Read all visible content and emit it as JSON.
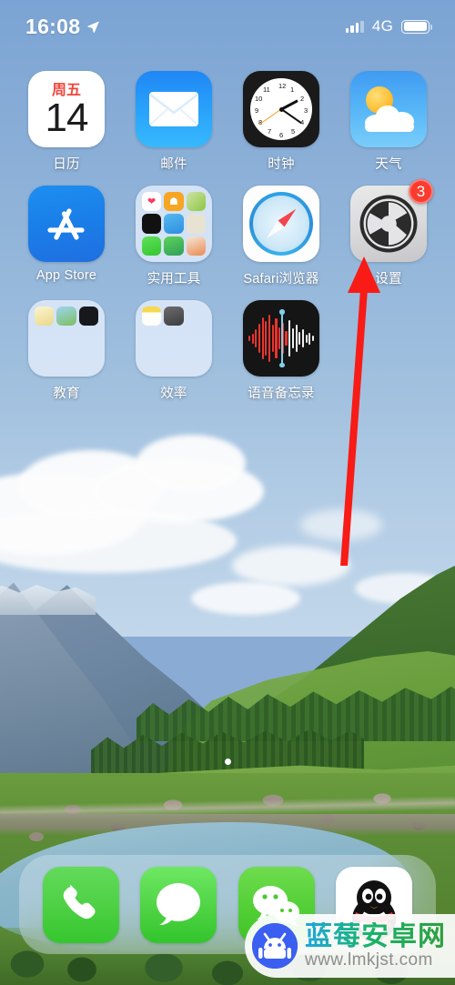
{
  "statusbar": {
    "time": "16:08",
    "location_icon": "location-arrow-icon",
    "signal_icon": "signal-bars-icon",
    "carrier": "4G",
    "battery_icon": "battery-full-icon"
  },
  "home": {
    "page_dots": {
      "count": 1,
      "active_index": 0
    },
    "apps": [
      {
        "id": "calendar",
        "label": "日历",
        "icon": "calendar-icon",
        "badge": null,
        "day_of_week": "周五",
        "day": "14"
      },
      {
        "id": "mail",
        "label": "邮件",
        "icon": "mail-icon",
        "badge": null
      },
      {
        "id": "clock",
        "label": "时钟",
        "icon": "clock-icon",
        "badge": null
      },
      {
        "id": "weather",
        "label": "天气",
        "icon": "weather-icon",
        "badge": null
      },
      {
        "id": "appstore",
        "label": "App Store",
        "icon": "app-store-icon",
        "badge": null
      },
      {
        "id": "utilities",
        "label": "实用工具",
        "icon": "folder-icon",
        "badge": null,
        "is_folder": true
      },
      {
        "id": "safari",
        "label": "Safari浏览器",
        "icon": "safari-icon",
        "badge": null
      },
      {
        "id": "settings",
        "label": "设置",
        "icon": "settings-gear-icon",
        "badge": "3"
      },
      {
        "id": "education",
        "label": "教育",
        "icon": "folder-icon",
        "badge": null,
        "is_folder": true
      },
      {
        "id": "efficiency",
        "label": "效率",
        "icon": "folder-icon",
        "badge": null,
        "is_folder": true
      },
      {
        "id": "voicememos",
        "label": "语音备忘录",
        "icon": "voice-memos-icon",
        "badge": null
      }
    ]
  },
  "dock": {
    "items": [
      {
        "id": "phone",
        "icon": "phone-icon"
      },
      {
        "id": "messages",
        "icon": "messages-icon"
      },
      {
        "id": "wechat",
        "icon": "wechat-icon"
      },
      {
        "id": "qq",
        "icon": "qq-penguin-icon"
      }
    ]
  },
  "annotation": {
    "type": "red-arrow",
    "color": "#f81b16",
    "points_to": "设置"
  },
  "watermark": {
    "site_name": "蓝莓安卓网",
    "url": "www.lmkjst.com",
    "logo_icon": "android-robot-icon"
  }
}
